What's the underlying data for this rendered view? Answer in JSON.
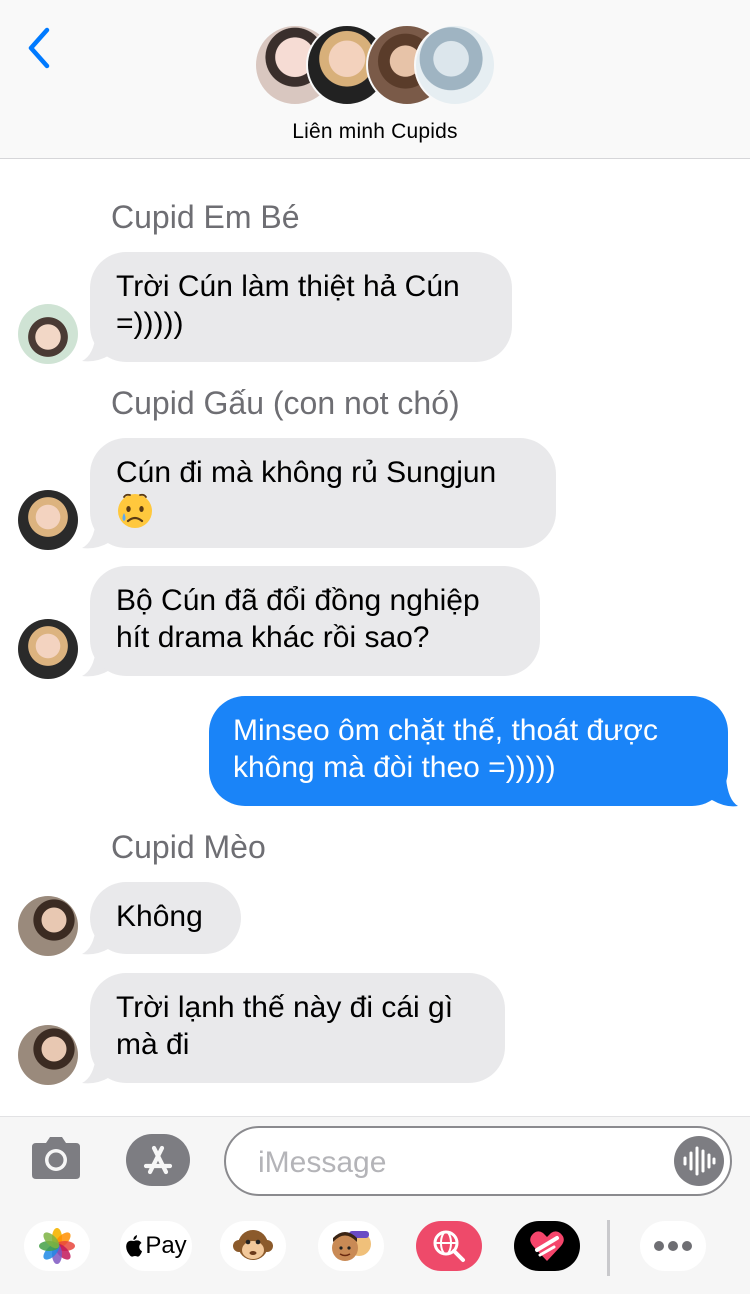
{
  "header": {
    "group_name": "Liên minh Cupids",
    "avatar_count": 4
  },
  "messages": [
    {
      "sender": "Cupid Em Bé",
      "lines": [
        "Trời Cún làm thiệt hả Cún",
        "=)))))"
      ]
    },
    {
      "sender": "Cupid Gấu (con not chó)",
      "lines": [
        "Cún đi mà không rủ Sungjun"
      ],
      "emoji": "crying-face"
    },
    {
      "sender": "",
      "lines": [
        "Bộ Cún đã đổi đồng nghiệp",
        "hít drama khác rồi sao?"
      ]
    },
    {
      "sender": "me",
      "lines": [
        "Minseo ôm chặt thế, thoát được",
        "không mà đòi theo =)))))"
      ]
    },
    {
      "sender": "Cupid Mèo",
      "lines": [
        "Không"
      ]
    },
    {
      "sender": "",
      "lines": [
        "Trời lạnh thế này đi cái gì",
        "mà đi"
      ]
    }
  ],
  "composer": {
    "placeholder": "iMessage",
    "apple_pay_label": "Pay"
  },
  "colors": {
    "outgoing": "#1a84f8",
    "incoming": "#e9e9eb",
    "accent": "#007aff",
    "sender_name": "#6e6e73"
  },
  "icons": [
    "chevron-left-icon",
    "camera-icon",
    "app-store-icon",
    "audio-waveform-icon",
    "photos-icon",
    "apple-pay-icon",
    "monkey-memoji-icon",
    "memoji-stickers-icon",
    "web-search-icon",
    "heart-digital-touch-icon",
    "more-icon"
  ]
}
